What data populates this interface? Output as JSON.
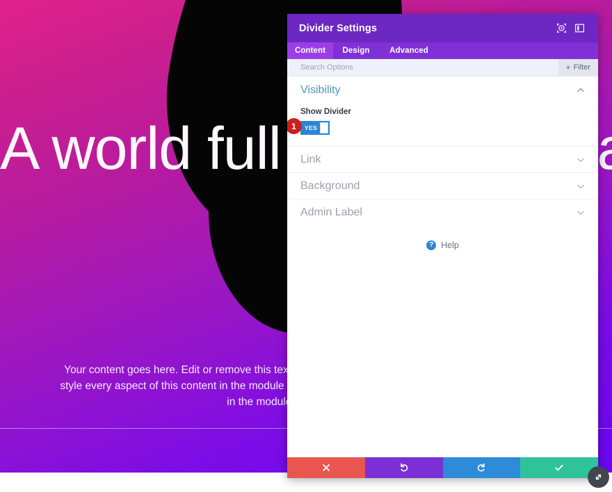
{
  "page": {
    "heading": "A world full of beautiful animations",
    "body": "Your content goes here. Edit or remove this text inline or in the module Content settings. You can also style every aspect of this content in the module Design settings and even apply custom CSS to this text in the module Advanced settings.",
    "gradient_start": "#e0218a",
    "gradient_end": "#6a06f2",
    "divider_color": "#ffffff"
  },
  "modal": {
    "title": "Divider Settings",
    "header_color": "#6d28c3",
    "header_icons": [
      {
        "name": "target-icon",
        "label": "Focus"
      },
      {
        "name": "panel-layout-icon",
        "label": "Layout"
      }
    ],
    "tabs": [
      {
        "label": "Content",
        "active": true
      },
      {
        "label": "Design",
        "active": false
      },
      {
        "label": "Advanced",
        "active": false
      }
    ],
    "search": {
      "placeholder": "Search Options",
      "value": "",
      "filter_label": "Filter",
      "filter_plus": "+"
    },
    "sections": [
      {
        "title": "Visibility",
        "expanded": true,
        "title_color": "#4a96c9",
        "field": {
          "label": "Show Divider",
          "toggle_value": "YES",
          "toggle_color": "#2b87d6",
          "step_badge": "1"
        }
      },
      {
        "title": "Link",
        "expanded": false
      },
      {
        "title": "Background",
        "expanded": false
      },
      {
        "title": "Admin Label",
        "expanded": false
      }
    ],
    "help": {
      "glyph": "?",
      "label": "Help"
    },
    "footer_buttons": [
      {
        "name": "cancel-button",
        "icon": "close-icon",
        "color": "#e9564f"
      },
      {
        "name": "undo-button",
        "icon": "undo-icon",
        "color": "#7b2fd4"
      },
      {
        "name": "redo-button",
        "icon": "redo-icon",
        "color": "#2e8bd9"
      },
      {
        "name": "save-button",
        "icon": "check-icon",
        "color": "#2fc39b"
      }
    ]
  }
}
